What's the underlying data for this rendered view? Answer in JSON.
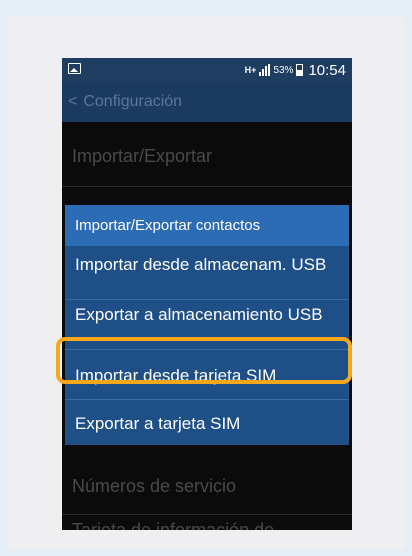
{
  "status_bar": {
    "network": "H+",
    "battery_percent": "53%",
    "time": "10:54"
  },
  "action_bar": {
    "title": "Configuración"
  },
  "settings": {
    "section_title": "Importar/Exportar",
    "items": [
      "Números de servicio",
      "Tarjeta de información de..."
    ]
  },
  "dialog": {
    "title": "Importar/Exportar contactos",
    "options": [
      "Importar desde almacenam. USB",
      "Exportar a almacenamiento USB",
      "Importar desde tarjeta SIM",
      "Exportar a tarjeta SIM"
    ],
    "highlighted_option_index": 2
  },
  "colors": {
    "highlight": "#f6a81a",
    "dialog_bg": "#1e4f86",
    "dialog_title_bg": "#2c6cb4",
    "action_bar_bg": "#1a3a5f"
  }
}
